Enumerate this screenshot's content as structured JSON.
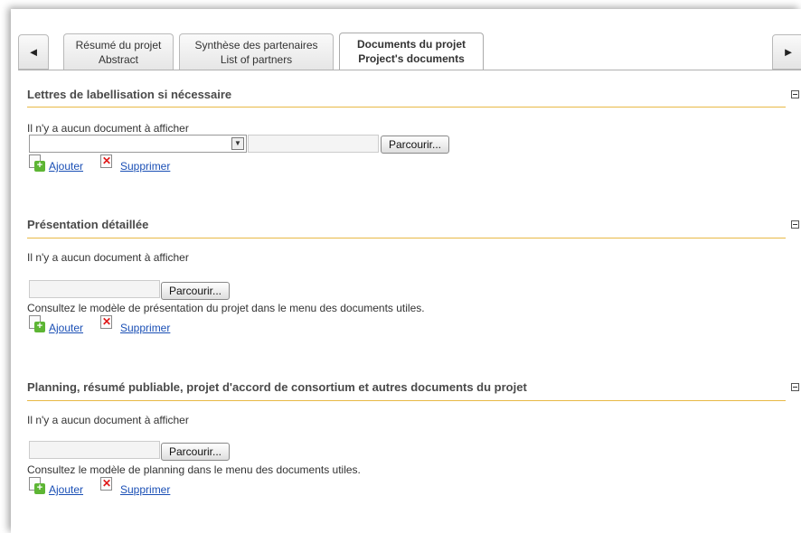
{
  "tabs": {
    "prev_arrow": "◄",
    "next_arrow": "►",
    "items": [
      {
        "line1": "Résumé du projet",
        "line2": "Abstract"
      },
      {
        "line1": "Synthèse des partenaires",
        "line2": "List of partners"
      },
      {
        "line1": "Documents du projet",
        "line2": "Project's documents"
      }
    ],
    "active_index": 2
  },
  "sections": [
    {
      "title": "Lettres de labellisation si nécessaire",
      "empty_text": "Il n'y a aucun document à afficher",
      "browse_label": "Parcourir...",
      "add_label": "Ajouter",
      "delete_label": "Supprimer"
    },
    {
      "title": "Présentation détaillée",
      "empty_text": "Il n'y a aucun document à afficher",
      "browse_label": "Parcourir...",
      "hint": "Consultez le modèle de présentation du projet dans le menu des documents utiles.",
      "add_label": "Ajouter",
      "delete_label": "Supprimer"
    },
    {
      "title": "Planning, résumé publiable, projet d'accord de consortium et autres documents du projet",
      "empty_text": "Il n'y a aucun document à afficher",
      "browse_label": "Parcourir...",
      "hint": "Consultez le modèle de planning dans le menu des documents utiles.",
      "add_label": "Ajouter",
      "delete_label": "Supprimer"
    }
  ],
  "colors": {
    "section_rule": "#e8b945",
    "link": "#1a4fb5"
  }
}
